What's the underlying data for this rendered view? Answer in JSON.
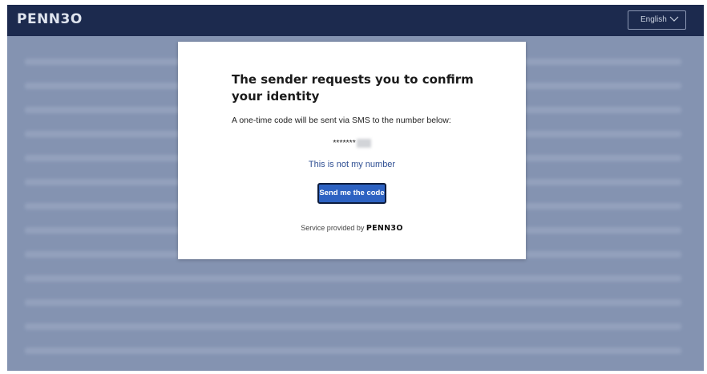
{
  "header": {
    "logo": "PENN3O",
    "language": "English",
    "language_icon": "chevron-down-icon"
  },
  "modal": {
    "title": "The sender requests you to confirm your identity",
    "description": "A one-time code will be sent via SMS to the number below:",
    "masked_number": "*******",
    "not_my_number_link": "This is not my number",
    "send_button_label": "Send me the code",
    "footer_prefix": "Service provided by",
    "footer_brand": "PENN3O"
  },
  "colors": {
    "topbar": "#1c2a4e",
    "backdrop": "#8493b1",
    "button": "#2d62c2",
    "link": "#2f4f93"
  }
}
